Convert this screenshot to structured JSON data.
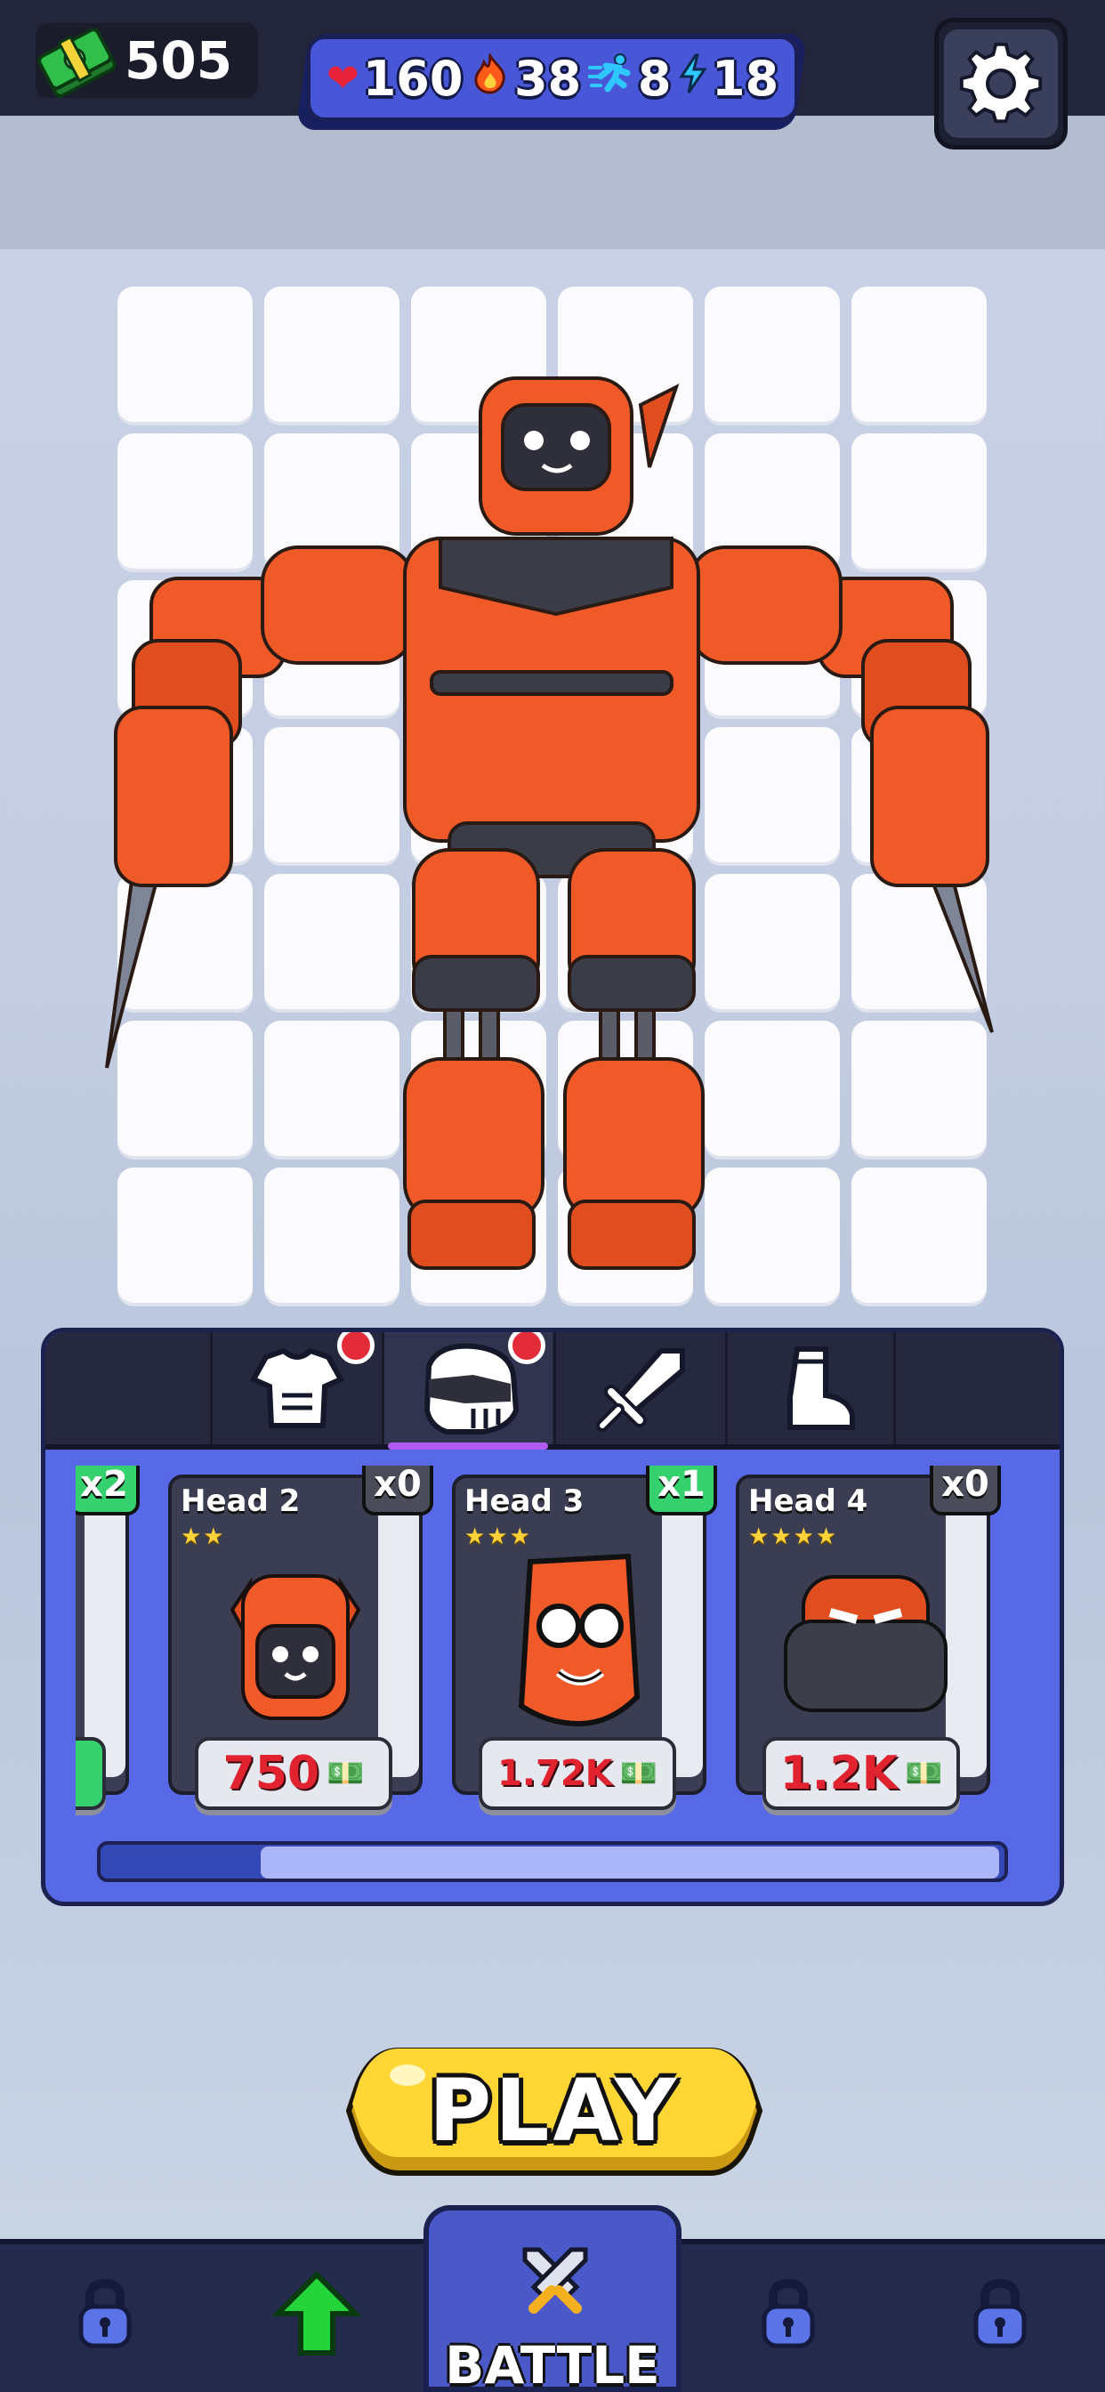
{
  "currency": {
    "amount": "505",
    "icon": "cash-stack-icon"
  },
  "stats": [
    {
      "icon": "heart-icon",
      "value": "160",
      "color": "#e8233a"
    },
    {
      "icon": "fire-icon",
      "value": "38",
      "color": "#ff6a1a"
    },
    {
      "icon": "runner-icon",
      "value": "8",
      "color": "#2fc7ff"
    },
    {
      "icon": "lightning-icon",
      "value": "18",
      "color": "#2fc7ff"
    }
  ],
  "settings": {
    "icon": "gear-icon"
  },
  "tabs": [
    {
      "icon": "armor-icon",
      "notify": true
    },
    {
      "icon": "helmet-icon",
      "notify": true,
      "active": true
    },
    {
      "icon": "sword-icon",
      "notify": false
    },
    {
      "icon": "boot-icon",
      "notify": false
    }
  ],
  "cards": [
    {
      "title": "",
      "stars": "",
      "qty": "x2",
      "price": ""
    },
    {
      "title": "Head 2",
      "stars": "★★",
      "qty": "x0",
      "price": "750"
    },
    {
      "title": "Head 3",
      "stars": "★★★",
      "qty": "x1",
      "price": "1.72K"
    },
    {
      "title": "Head 4",
      "stars": "★★★★",
      "qty": "x0",
      "price": "1.2K"
    }
  ],
  "play": {
    "label": "PLAY"
  },
  "nav": {
    "battle_label": "BATTLE",
    "items": [
      {
        "icon": "lock-icon"
      },
      {
        "icon": "upgrade-arrow-icon"
      },
      {
        "icon": "battle-swords-icon"
      },
      {
        "icon": "lock-icon"
      },
      {
        "icon": "lock-icon"
      }
    ]
  },
  "colors": {
    "accent": "#5769e6",
    "robot": "#f05a28",
    "play": "#ffd633"
  }
}
